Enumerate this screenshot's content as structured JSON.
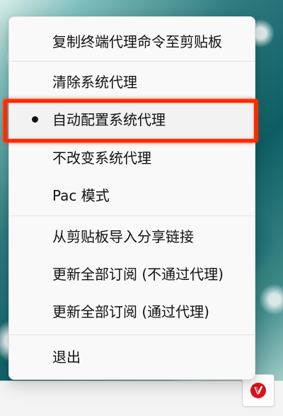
{
  "menu": {
    "items": [
      {
        "label": "复制终端代理命令至剪贴板",
        "selected": false
      },
      {
        "label": "清除系统代理",
        "selected": false
      },
      {
        "label": "自动配置系统代理",
        "selected": true
      },
      {
        "label": "不改变系统代理",
        "selected": false
      },
      {
        "label": "Pac 模式",
        "selected": false
      },
      {
        "label": "从剪贴板导入分享链接",
        "selected": false
      },
      {
        "label": "更新全部订阅 (不通过代理)",
        "selected": false
      },
      {
        "label": "更新全部订阅 (通过代理)",
        "selected": false
      },
      {
        "label": "退出",
        "selected": false
      }
    ]
  },
  "tray": {
    "icon": "v2rayn-tray-icon"
  },
  "annotation": {
    "color": "#ff2a00"
  }
}
